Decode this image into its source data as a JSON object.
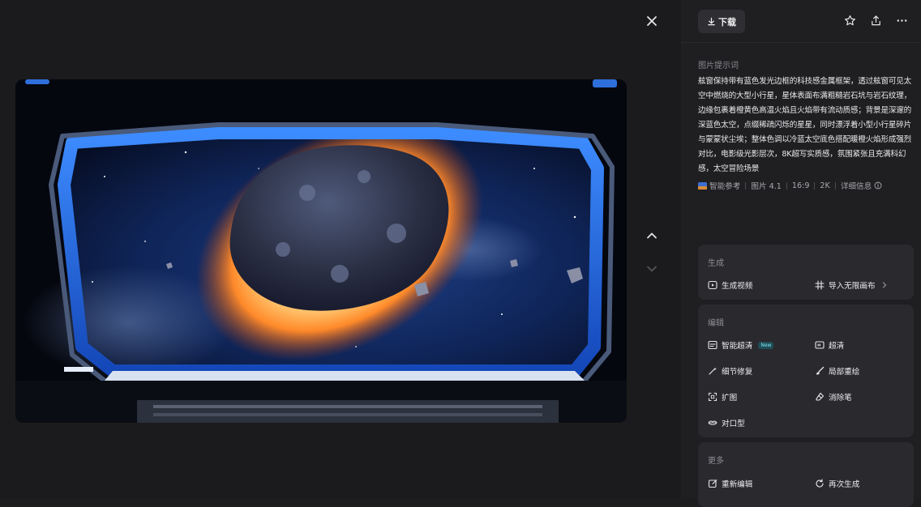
{
  "viewer": {
    "close_icon": "close-icon",
    "nav_up_icon": "chevron-up-icon",
    "nav_down_icon": "chevron-down-icon",
    "image_description": "asteroid-through-spaceship-window"
  },
  "toolbar": {
    "download_label": "下载",
    "download_icon": "download-icon",
    "favorite_icon": "star-icon",
    "share_icon": "share-icon",
    "more_icon": "more-icon"
  },
  "prompt": {
    "label": "图片提示词",
    "text": "舷窗保持带有蓝色发光边框的科技感金属框架，透过舷窗可见太空中燃烧的大型小行星，星体表面布满粗糙岩石坑与岩石纹理，边缘包裹着橙黄色高温火焰且火焰带有流动质感；背景是深邃的深蓝色太空，点缀稀疏闪烁的星星，同时漂浮着小型小行星碎片与蒙蒙状尘埃；整体色调以冷蓝太空底色搭配暖橙火焰形成强烈对比，电影级光影层次，8K超写实质感，氛围紧张且充满科幻感，太空冒险场景"
  },
  "meta": {
    "reference": "智能参考",
    "model": "图片 4.1",
    "ratio": "16:9",
    "resolution": "2K",
    "details": "详细信息"
  },
  "generate": {
    "title": "生成",
    "video": "生成视频",
    "canvas": "导入无限画布"
  },
  "edit": {
    "title": "编辑",
    "smart_remove": "智能超清",
    "new_badge": "New",
    "super_res": "超清",
    "detail_fix": "细节修复",
    "partial_redraw": "局部重绘",
    "expand": "扩图",
    "eraser": "消除笔",
    "lip_sync": "对口型"
  },
  "more": {
    "title": "更多",
    "re_edit": "重新编辑",
    "regenerate": "再次生成"
  }
}
